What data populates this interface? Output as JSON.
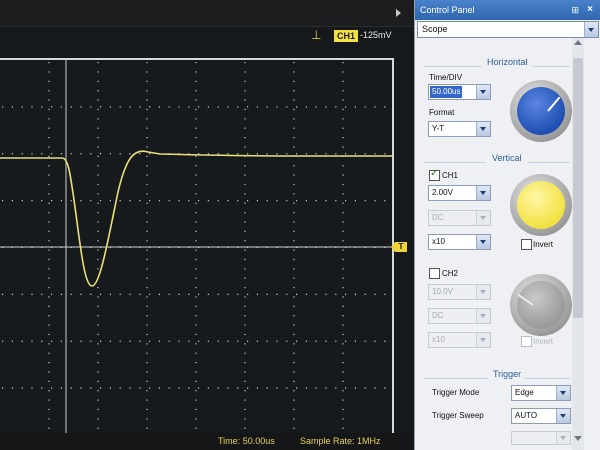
{
  "scope": {
    "trigger_badge": "CH1",
    "trigger_level": "-125mV",
    "trigger_marker": "T",
    "bottom": {
      "time_label": "Time:",
      "time_value": "50.00us",
      "rate_label": "Sample Rate:",
      "rate_value": "1MHz"
    }
  },
  "panel": {
    "title": "Control Panel",
    "title_icons": {
      "pin": "pin-icon",
      "close": "close-icon"
    },
    "instrument_select": "Scope",
    "horizontal": {
      "section_title": "Horizontal",
      "time_div_label": "Time/DIV",
      "time_div_value": "50.00us",
      "format_label": "Format",
      "format_value": "Y-T"
    },
    "vertical": {
      "section_title": "Vertical",
      "ch1": {
        "label": "CH1",
        "checked": true,
        "volts": "2.00V",
        "coupling": "DC",
        "probe": "x10",
        "invert_label": "Invert",
        "knob_color": "#f2e241"
      },
      "ch2": {
        "label": "CH2",
        "checked": false,
        "volts": "10.0V",
        "coupling": "DC",
        "probe": "x10",
        "invert_label": "Invert",
        "knob_color": "#9a9a9a"
      }
    },
    "trigger": {
      "section_title": "Trigger",
      "mode_label": "Trigger Mode",
      "mode_value": "Edge",
      "sweep_label": "Trigger Sweep",
      "sweep_value": "AUTO"
    },
    "horizontal_knob_color": "#1f4fb3"
  },
  "colors": {
    "trace": "#e9e07a",
    "grid": "#cfcfcf"
  }
}
